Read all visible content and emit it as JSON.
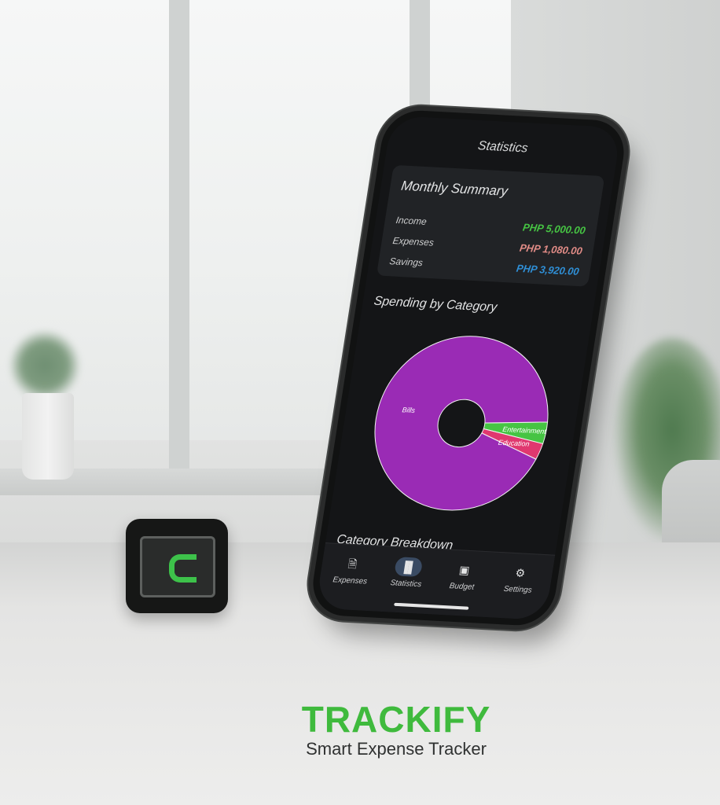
{
  "screen": {
    "title": "Statistics"
  },
  "summary": {
    "title": "Monthly Summary",
    "rows": [
      {
        "label": "Income",
        "value": "PHP 5,000.00",
        "color": "#46c443"
      },
      {
        "label": "Expenses",
        "value": "PHP 1,080.00",
        "color": "#e08b86"
      },
      {
        "label": "Savings",
        "value": "PHP 3,920.00",
        "color": "#2f8fd6"
      }
    ]
  },
  "spending": {
    "title": "Spending by Category",
    "chart_data": {
      "type": "pie",
      "categories": [
        "Bills",
        "Entertainment",
        "Education"
      ],
      "values": [
        93,
        4,
        3
      ],
      "colors": [
        "#9a2bb5",
        "#46c443",
        "#e0386f"
      ]
    }
  },
  "breakdown": {
    "title": "Category Breakdown"
  },
  "nav": {
    "items": [
      {
        "label": "Expenses",
        "icon": "receipt-icon"
      },
      {
        "label": "Statistics",
        "icon": "bar-chart-icon"
      },
      {
        "label": "Budget",
        "icon": "wallet-icon"
      },
      {
        "label": "Settings",
        "icon": "gear-icon"
      }
    ]
  },
  "brand": {
    "name": "TRACKIFY",
    "tagline": "Smart Expense Tracker",
    "accent": "#3fba3d"
  }
}
